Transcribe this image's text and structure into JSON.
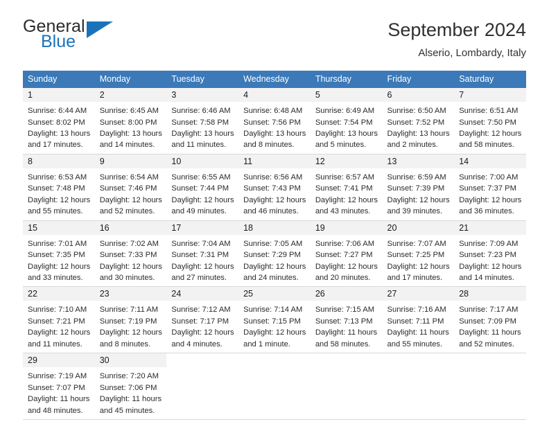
{
  "brand": {
    "name_part1": "General",
    "name_part2": "Blue",
    "triangle_color": "#1a72bb"
  },
  "header": {
    "title": "September 2024",
    "subtitle": "Alserio, Lombardy, Italy"
  },
  "theme": {
    "header_row_bg": "#3b79b8",
    "daynum_bg": "#f2f2f2",
    "grid_line": "#d8d8d8"
  },
  "weekdays": [
    "Sunday",
    "Monday",
    "Tuesday",
    "Wednesday",
    "Thursday",
    "Friday",
    "Saturday"
  ],
  "labels": {
    "sunrise_prefix": "Sunrise:",
    "sunset_prefix": "Sunset:",
    "daylight_prefix": "Daylight:"
  },
  "weeks": [
    [
      {
        "day": "1",
        "sunrise": "Sunrise: 6:44 AM",
        "sunset": "Sunset: 8:02 PM",
        "daylight": "Daylight: 13 hours and 17 minutes."
      },
      {
        "day": "2",
        "sunrise": "Sunrise: 6:45 AM",
        "sunset": "Sunset: 8:00 PM",
        "daylight": "Daylight: 13 hours and 14 minutes."
      },
      {
        "day": "3",
        "sunrise": "Sunrise: 6:46 AM",
        "sunset": "Sunset: 7:58 PM",
        "daylight": "Daylight: 13 hours and 11 minutes."
      },
      {
        "day": "4",
        "sunrise": "Sunrise: 6:48 AM",
        "sunset": "Sunset: 7:56 PM",
        "daylight": "Daylight: 13 hours and 8 minutes."
      },
      {
        "day": "5",
        "sunrise": "Sunrise: 6:49 AM",
        "sunset": "Sunset: 7:54 PM",
        "daylight": "Daylight: 13 hours and 5 minutes."
      },
      {
        "day": "6",
        "sunrise": "Sunrise: 6:50 AM",
        "sunset": "Sunset: 7:52 PM",
        "daylight": "Daylight: 13 hours and 2 minutes."
      },
      {
        "day": "7",
        "sunrise": "Sunrise: 6:51 AM",
        "sunset": "Sunset: 7:50 PM",
        "daylight": "Daylight: 12 hours and 58 minutes."
      }
    ],
    [
      {
        "day": "8",
        "sunrise": "Sunrise: 6:53 AM",
        "sunset": "Sunset: 7:48 PM",
        "daylight": "Daylight: 12 hours and 55 minutes."
      },
      {
        "day": "9",
        "sunrise": "Sunrise: 6:54 AM",
        "sunset": "Sunset: 7:46 PM",
        "daylight": "Daylight: 12 hours and 52 minutes."
      },
      {
        "day": "10",
        "sunrise": "Sunrise: 6:55 AM",
        "sunset": "Sunset: 7:44 PM",
        "daylight": "Daylight: 12 hours and 49 minutes."
      },
      {
        "day": "11",
        "sunrise": "Sunrise: 6:56 AM",
        "sunset": "Sunset: 7:43 PM",
        "daylight": "Daylight: 12 hours and 46 minutes."
      },
      {
        "day": "12",
        "sunrise": "Sunrise: 6:57 AM",
        "sunset": "Sunset: 7:41 PM",
        "daylight": "Daylight: 12 hours and 43 minutes."
      },
      {
        "day": "13",
        "sunrise": "Sunrise: 6:59 AM",
        "sunset": "Sunset: 7:39 PM",
        "daylight": "Daylight: 12 hours and 39 minutes."
      },
      {
        "day": "14",
        "sunrise": "Sunrise: 7:00 AM",
        "sunset": "Sunset: 7:37 PM",
        "daylight": "Daylight: 12 hours and 36 minutes."
      }
    ],
    [
      {
        "day": "15",
        "sunrise": "Sunrise: 7:01 AM",
        "sunset": "Sunset: 7:35 PM",
        "daylight": "Daylight: 12 hours and 33 minutes."
      },
      {
        "day": "16",
        "sunrise": "Sunrise: 7:02 AM",
        "sunset": "Sunset: 7:33 PM",
        "daylight": "Daylight: 12 hours and 30 minutes."
      },
      {
        "day": "17",
        "sunrise": "Sunrise: 7:04 AM",
        "sunset": "Sunset: 7:31 PM",
        "daylight": "Daylight: 12 hours and 27 minutes."
      },
      {
        "day": "18",
        "sunrise": "Sunrise: 7:05 AM",
        "sunset": "Sunset: 7:29 PM",
        "daylight": "Daylight: 12 hours and 24 minutes."
      },
      {
        "day": "19",
        "sunrise": "Sunrise: 7:06 AM",
        "sunset": "Sunset: 7:27 PM",
        "daylight": "Daylight: 12 hours and 20 minutes."
      },
      {
        "day": "20",
        "sunrise": "Sunrise: 7:07 AM",
        "sunset": "Sunset: 7:25 PM",
        "daylight": "Daylight: 12 hours and 17 minutes."
      },
      {
        "day": "21",
        "sunrise": "Sunrise: 7:09 AM",
        "sunset": "Sunset: 7:23 PM",
        "daylight": "Daylight: 12 hours and 14 minutes."
      }
    ],
    [
      {
        "day": "22",
        "sunrise": "Sunrise: 7:10 AM",
        "sunset": "Sunset: 7:21 PM",
        "daylight": "Daylight: 12 hours and 11 minutes."
      },
      {
        "day": "23",
        "sunrise": "Sunrise: 7:11 AM",
        "sunset": "Sunset: 7:19 PM",
        "daylight": "Daylight: 12 hours and 8 minutes."
      },
      {
        "day": "24",
        "sunrise": "Sunrise: 7:12 AM",
        "sunset": "Sunset: 7:17 PM",
        "daylight": "Daylight: 12 hours and 4 minutes."
      },
      {
        "day": "25",
        "sunrise": "Sunrise: 7:14 AM",
        "sunset": "Sunset: 7:15 PM",
        "daylight": "Daylight: 12 hours and 1 minute."
      },
      {
        "day": "26",
        "sunrise": "Sunrise: 7:15 AM",
        "sunset": "Sunset: 7:13 PM",
        "daylight": "Daylight: 11 hours and 58 minutes."
      },
      {
        "day": "27",
        "sunrise": "Sunrise: 7:16 AM",
        "sunset": "Sunset: 7:11 PM",
        "daylight": "Daylight: 11 hours and 55 minutes."
      },
      {
        "day": "28",
        "sunrise": "Sunrise: 7:17 AM",
        "sunset": "Sunset: 7:09 PM",
        "daylight": "Daylight: 11 hours and 52 minutes."
      }
    ],
    [
      {
        "day": "29",
        "sunrise": "Sunrise: 7:19 AM",
        "sunset": "Sunset: 7:07 PM",
        "daylight": "Daylight: 11 hours and 48 minutes."
      },
      {
        "day": "30",
        "sunrise": "Sunrise: 7:20 AM",
        "sunset": "Sunset: 7:06 PM",
        "daylight": "Daylight: 11 hours and 45 minutes."
      },
      null,
      null,
      null,
      null,
      null
    ]
  ]
}
